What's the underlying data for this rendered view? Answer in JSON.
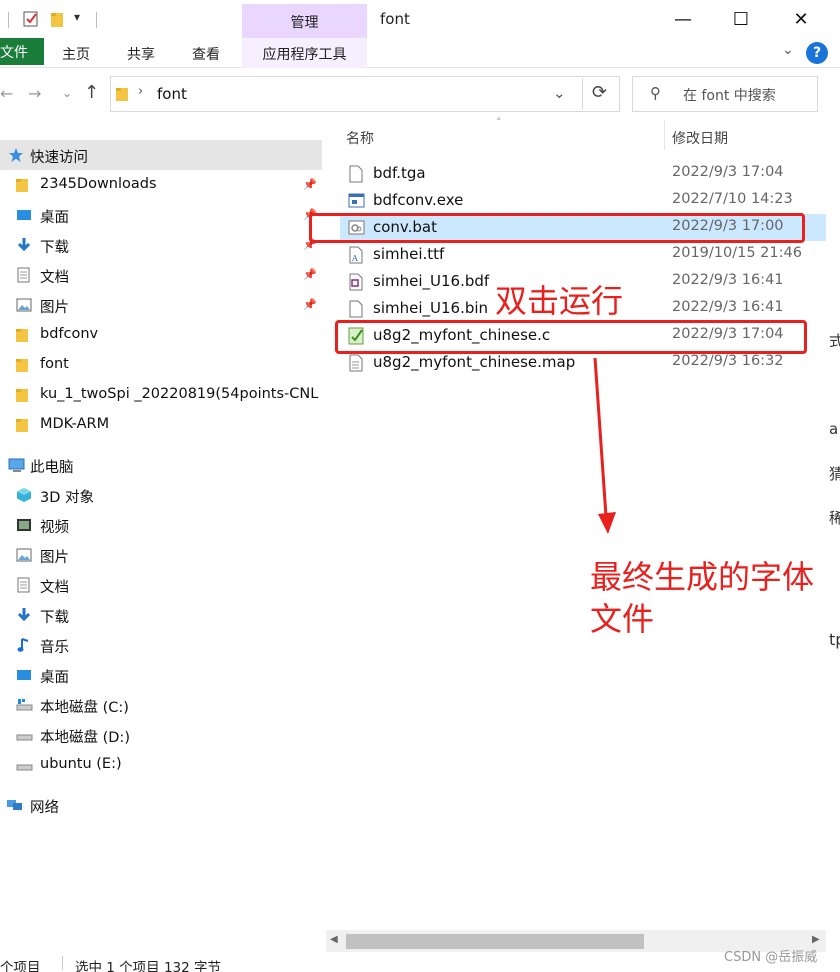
{
  "window": {
    "title": "font",
    "manage_label": "管理",
    "minimize": "—",
    "maximize": "☐",
    "close": "✕"
  },
  "ribbon": {
    "file_tab": "文件",
    "tabs": [
      "主页",
      "共享",
      "查看"
    ],
    "app_tools": "应用程序工具",
    "help": "?"
  },
  "address": {
    "path": "font",
    "search_placeholder": "在 font 中搜索"
  },
  "nav": {
    "quick_access": "快速访问",
    "quick_items": [
      {
        "label": "2345Downloads",
        "pinned": true
      },
      {
        "label": "桌面",
        "pinned": true
      },
      {
        "label": "下载",
        "pinned": true
      },
      {
        "label": "文档",
        "pinned": true
      },
      {
        "label": "图片",
        "pinned": true
      },
      {
        "label": "bdfconv",
        "pinned": false
      },
      {
        "label": "font",
        "pinned": false
      },
      {
        "label": "ku_1_twoSpi _20220819(54points-CNL",
        "pinned": false
      },
      {
        "label": "MDK-ARM",
        "pinned": false
      }
    ],
    "this_pc": "此电脑",
    "pc_items": [
      "3D 对象",
      "视频",
      "图片",
      "文档",
      "下载",
      "音乐",
      "桌面",
      "本地磁盘 (C:)",
      "本地磁盘 (D:)",
      "ubuntu (E:)"
    ],
    "network": "网络"
  },
  "list": {
    "col_name": "名称",
    "col_date": "修改日期",
    "files": [
      {
        "name": "bdf.tga",
        "date": "2022/9/3 17:04",
        "icon": "blank-file-icon"
      },
      {
        "name": "bdfconv.exe",
        "date": "2022/7/10 14:23",
        "icon": "exe-icon"
      },
      {
        "name": "conv.bat",
        "date": "2022/9/3 17:00",
        "icon": "bat-icon",
        "selected": true
      },
      {
        "name": "simhei.ttf",
        "date": "2019/10/15 21:46",
        "icon": "font-file-icon"
      },
      {
        "name": "simhei_U16.bdf",
        "date": "2022/9/3 16:41",
        "icon": "bdf-file-icon"
      },
      {
        "name": "simhei_U16.bin",
        "date": "2022/9/3 16:41",
        "icon": "blank-file-icon"
      },
      {
        "name": "u8g2_myfont_chinese.c",
        "date": "2022/9/3 17:04",
        "icon": "c-file-icon"
      },
      {
        "name": "u8g2_myfont_chinese.map",
        "date": "2022/9/3 16:32",
        "icon": "map-file-icon"
      }
    ]
  },
  "annotations": {
    "double_click": "双击运行",
    "final_line1": "最终生成的字体",
    "final_line2": "文件",
    "color": "#e8201e"
  },
  "status": {
    "count": "个项目",
    "selected": "选中 1 个项目  132 字节"
  },
  "watermark": "CSDN @岳振威",
  "right_edge_glyphs": [
    "式",
    "a",
    "猜",
    "稀",
    "tp"
  ]
}
